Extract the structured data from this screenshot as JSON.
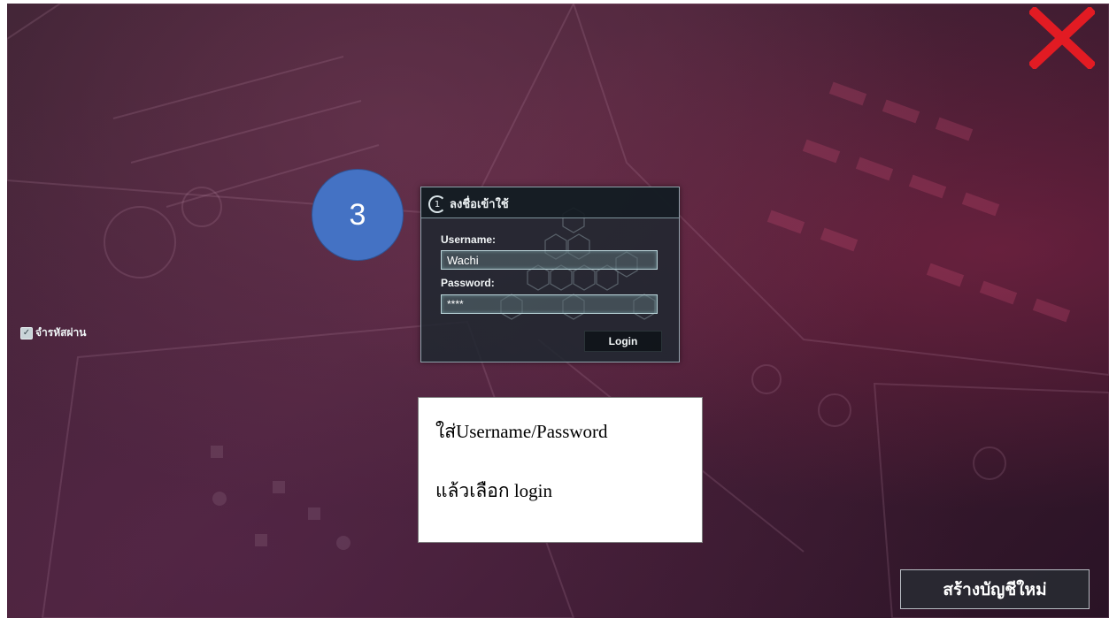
{
  "app": {
    "close_icon": "close-x-icon",
    "close_color": "#e21b23"
  },
  "step_badge": {
    "number": "3",
    "color": "#4472c4"
  },
  "login_panel": {
    "header_icon_text": "1",
    "title": "ลงชื่อเข้าใช้",
    "username_label": "Username:",
    "username_value": "Wachi",
    "password_label": "Password:",
    "password_value": "****",
    "remember_label": "จำรหัสผ่าน",
    "remember_checked": true,
    "login_label": "Login"
  },
  "instruction": {
    "line1": "ใส่Username/Password",
    "line2": "แล้วเลือก login"
  },
  "footer": {
    "create_account_label": "สร้างบัญชีใหม่"
  }
}
